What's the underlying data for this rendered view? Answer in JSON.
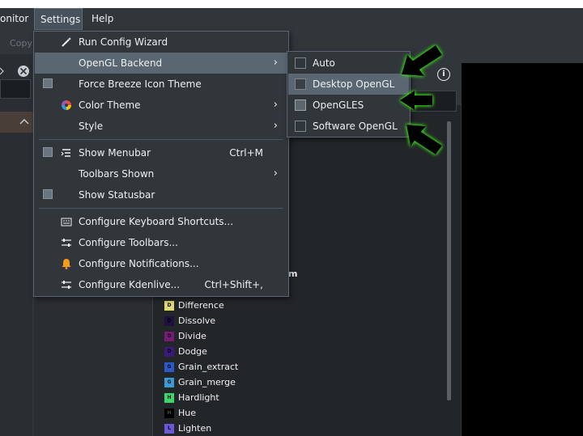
{
  "menubar": {
    "items": [
      {
        "label": "onitor"
      },
      {
        "label": "Settings"
      },
      {
        "label": "Help"
      }
    ]
  },
  "toolbar": {
    "copy_label": "Copy"
  },
  "settings_menu": {
    "items": [
      {
        "label": "Run Config Wizard",
        "icon": "wand-icon"
      },
      {
        "label": "OpenGL Backend",
        "submenu": true
      },
      {
        "label": "Force Breeze Icon Theme",
        "checkbox": true
      },
      {
        "label": "Color Theme",
        "icon": "color-wheel-icon",
        "submenu": true
      },
      {
        "label": "Style",
        "submenu": true
      },
      {
        "label": "Show Menubar",
        "checkbox": true,
        "icon": "menubar-icon",
        "shortcut": "Ctrl+M"
      },
      {
        "label": "Toolbars Shown",
        "submenu": true
      },
      {
        "label": "Show Statusbar",
        "checkbox": true
      },
      {
        "label": "Configure Keyboard Shortcuts...",
        "icon": "keyboard-icon"
      },
      {
        "label": "Configure Toolbars...",
        "icon": "configure-icon"
      },
      {
        "label": "Configure Notifications...",
        "icon": "bell-icon"
      },
      {
        "label": "Configure Kdenlive...",
        "icon": "configure-icon",
        "shortcut": "Ctrl+Shift+,"
      }
    ]
  },
  "opengl_submenu": {
    "items": [
      {
        "label": "Auto",
        "checked": false
      },
      {
        "label": "Desktop OpenGL",
        "checked": false
      },
      {
        "label": "OpenGLES",
        "checked": true
      },
      {
        "label": "Software OpenGL",
        "checked": false
      }
    ]
  },
  "effects_list": {
    "partial_heading": "m",
    "items": [
      {
        "label": "Difference",
        "letter": "D",
        "color": "#e0d870"
      },
      {
        "label": "Dissolve",
        "letter": "D",
        "color": "#1e1040"
      },
      {
        "label": "Divide",
        "letter": "D",
        "color": "#7a1a78"
      },
      {
        "label": "Dodge",
        "letter": "D",
        "color": "#3a1a78"
      },
      {
        "label": "Grain_extract",
        "letter": "G",
        "color": "#2a5ac8"
      },
      {
        "label": "Grain_merge",
        "letter": "G",
        "color": "#3a9ad8"
      },
      {
        "label": "Hardlight",
        "letter": "H",
        "color": "#3ad86a"
      },
      {
        "label": "Hue",
        "letter": "H",
        "color": "#000000"
      },
      {
        "label": "Lighten",
        "letter": "L",
        "color": "#6a58d8"
      }
    ]
  },
  "colors": {
    "menu_bg": "#31363b",
    "highlight": "#5a6772",
    "arrow_glow": "#3adf1e"
  }
}
